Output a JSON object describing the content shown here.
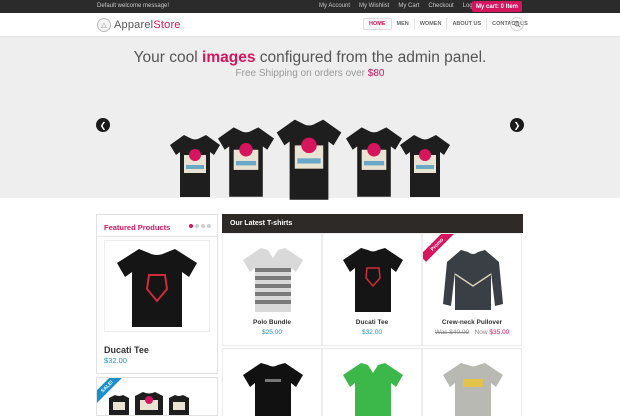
{
  "topbar": {
    "welcome": "Default welcome message!",
    "links": [
      "My Account",
      "My Wishlist",
      "My Cart",
      "Checkout",
      "Log In"
    ],
    "cart_button": "My cart: 0 Item"
  },
  "header": {
    "logo_text_1": "Apparel",
    "logo_text_2": "Store",
    "nav": [
      "HOME",
      "MEN",
      "WOMEN",
      "ABOUT US",
      "CONTACT US"
    ],
    "active_nav": "HOME"
  },
  "banner": {
    "title_pre": "Your cool ",
    "title_highlight": "images",
    "title_post": " configured from the admin panel.",
    "sub_pre": "Free Shipping on orders over ",
    "sub_price": "$80",
    "prev_icon": "chevron-left-icon",
    "next_icon": "chevron-right-icon"
  },
  "featured": {
    "title": "Featured Products",
    "product_name": "Ducati Tee",
    "product_price": "$32.00",
    "ribbon": "SALE!"
  },
  "latest": {
    "title": "Our Latest T-shirts",
    "ribbon": "Promo",
    "products": [
      {
        "name": "Polo Bundle",
        "price": "$25.00"
      },
      {
        "name": "Ducati Tee",
        "price": "$32.00"
      },
      {
        "name": "Crew-neck Pullover",
        "old_price": "Was $40.00",
        "now_label": "Now",
        "new_price": "$35.00"
      }
    ]
  },
  "colors": {
    "accent": "#d6155f",
    "price_blue": "#1a8fc9",
    "dark": "#2b2b2b"
  }
}
